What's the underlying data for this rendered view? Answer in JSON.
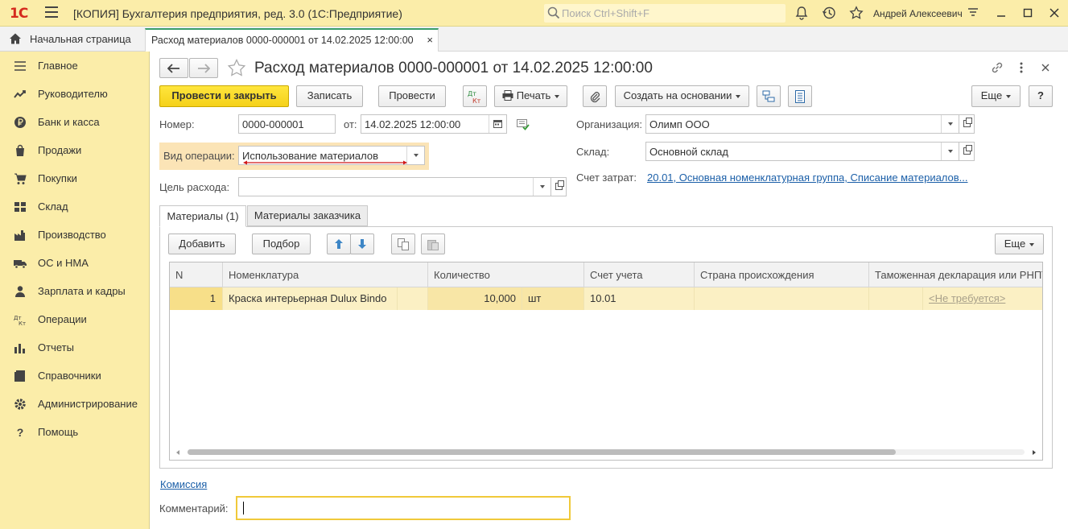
{
  "titlebar": {
    "logo": "1С",
    "app_title": "[КОПИЯ] Бухгалтерия предприятия, ред. 3.0  (1С:Предприятие)",
    "search_placeholder": "Поиск Ctrl+Shift+F",
    "user": "Андрей Алексеевич"
  },
  "tabs": {
    "home": "Начальная страница",
    "document": "Расход материалов 0000-000001 от 14.02.2025 12:00:00",
    "close": "×"
  },
  "sidebar": {
    "items": [
      {
        "label": "Главное",
        "icon": "menu-lines-icon"
      },
      {
        "label": "Руководителю",
        "icon": "trend-icon"
      },
      {
        "label": "Банк и касса",
        "icon": "ruble-coin-icon"
      },
      {
        "label": "Продажи",
        "icon": "shopping-bag-icon"
      },
      {
        "label": "Покупки",
        "icon": "cart-icon"
      },
      {
        "label": "Склад",
        "icon": "warehouse-icon"
      },
      {
        "label": "Производство",
        "icon": "factory-icon"
      },
      {
        "label": "ОС и НМА",
        "icon": "truck-icon"
      },
      {
        "label": "Зарплата и кадры",
        "icon": "person-icon"
      },
      {
        "label": "Операции",
        "icon": "dt-kt-icon"
      },
      {
        "label": "Отчеты",
        "icon": "bar-chart-icon"
      },
      {
        "label": "Справочники",
        "icon": "book-icon"
      },
      {
        "label": "Администрирование",
        "icon": "gear-icon"
      },
      {
        "label": "Помощь",
        "icon": "question-icon"
      }
    ]
  },
  "form": {
    "title": "Расход материалов 0000-000001 от 14.02.2025 12:00:00",
    "buttons": {
      "post_close": "Провести и закрыть",
      "save": "Записать",
      "post": "Провести",
      "dtkt": "Дт Кт",
      "print": "Печать",
      "create_based": "Создать на основании",
      "more": "Еще",
      "help": "?"
    },
    "number_label": "Номер:",
    "number_value": "0000-000001",
    "date_label": "от:",
    "date_value": "14.02.2025 12:00:00",
    "op_label": "Вид операции:",
    "op_value": "Использование материалов",
    "purpose_label": "Цель расхода:",
    "purpose_value": "",
    "org_label": "Организация:",
    "org_value": "Олимп ООО",
    "warehouse_label": "Склад:",
    "warehouse_value": "Основной склад",
    "cost_label": "Счет затрат:",
    "cost_value": "20.01, Основная номенклатурная группа, Списание материалов..."
  },
  "inner_tabs": [
    "Материалы (1)",
    "Материалы заказчика"
  ],
  "table_toolbar": {
    "add": "Добавить",
    "pick": "Подбор",
    "more": "Еще"
  },
  "table": {
    "columns": [
      "N",
      "Номенклатура",
      "Количество",
      "Счет учета",
      "Страна происхождения",
      "Таможенная декларация или РНПТ"
    ],
    "rows": [
      {
        "n": "1",
        "item": "Краска интерьерная Dulux Bindo",
        "qty": "10,000",
        "unit": "шт",
        "account": "10.01",
        "country": "",
        "customs": "<Не требуется>"
      }
    ]
  },
  "footer": {
    "commission_link": "Комиссия",
    "comment_label": "Комментарий:",
    "comment_value": ""
  }
}
